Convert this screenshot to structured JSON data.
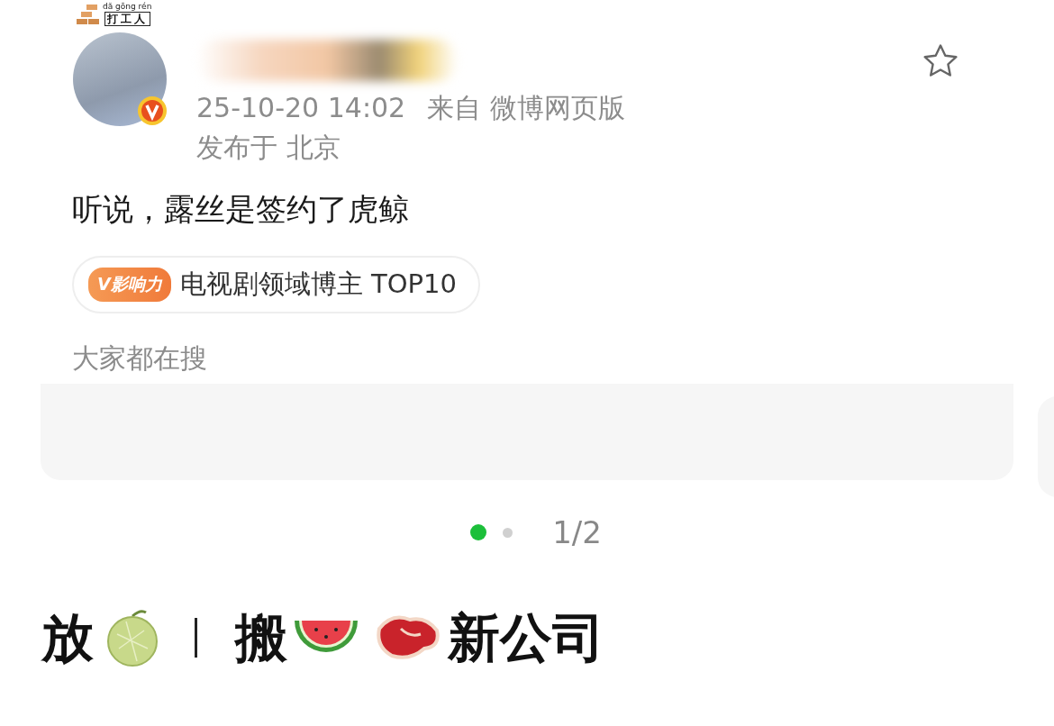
{
  "author": {
    "pendant": {
      "pinyin": "dǎ gōng rén",
      "text": "打工人"
    },
    "verified": true,
    "timestamp": "25-10-20 14:02",
    "source": "来自 微博网页版",
    "location": "发布于 北京"
  },
  "favorite": {
    "selected": false
  },
  "post": {
    "text": "听说，露丝是签约了虎鲸"
  },
  "badge": {
    "label": "V影响力",
    "text": "电视剧领域博主 TOP10"
  },
  "search": {
    "title": "大家都在搜"
  },
  "pager": {
    "pages": [
      {
        "selected": true
      },
      {
        "selected": false
      }
    ],
    "counter": "1/2"
  },
  "headline": {
    "parts": [
      "放",
      "搬",
      "新公司"
    ]
  }
}
